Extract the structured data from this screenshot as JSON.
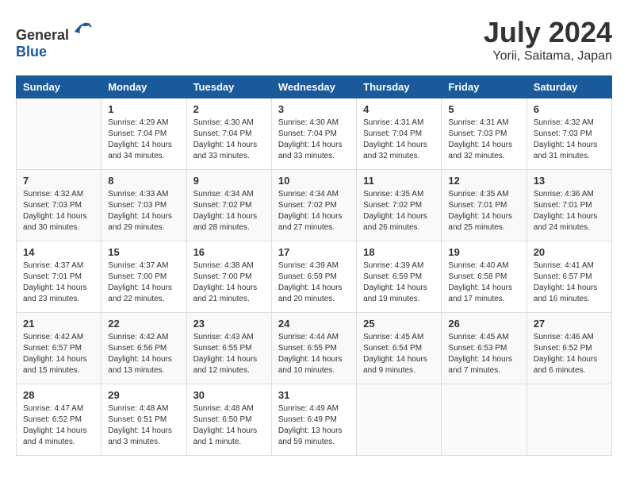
{
  "header": {
    "logo_general": "General",
    "logo_blue": "Blue",
    "month": "July 2024",
    "location": "Yorii, Saitama, Japan"
  },
  "days_of_week": [
    "Sunday",
    "Monday",
    "Tuesday",
    "Wednesday",
    "Thursday",
    "Friday",
    "Saturday"
  ],
  "weeks": [
    [
      {
        "day": "",
        "sunrise": "",
        "sunset": "",
        "daylight": ""
      },
      {
        "day": "1",
        "sunrise": "Sunrise: 4:29 AM",
        "sunset": "Sunset: 7:04 PM",
        "daylight": "Daylight: 14 hours and 34 minutes."
      },
      {
        "day": "2",
        "sunrise": "Sunrise: 4:30 AM",
        "sunset": "Sunset: 7:04 PM",
        "daylight": "Daylight: 14 hours and 33 minutes."
      },
      {
        "day": "3",
        "sunrise": "Sunrise: 4:30 AM",
        "sunset": "Sunset: 7:04 PM",
        "daylight": "Daylight: 14 hours and 33 minutes."
      },
      {
        "day": "4",
        "sunrise": "Sunrise: 4:31 AM",
        "sunset": "Sunset: 7:04 PM",
        "daylight": "Daylight: 14 hours and 32 minutes."
      },
      {
        "day": "5",
        "sunrise": "Sunrise: 4:31 AM",
        "sunset": "Sunset: 7:03 PM",
        "daylight": "Daylight: 14 hours and 32 minutes."
      },
      {
        "day": "6",
        "sunrise": "Sunrise: 4:32 AM",
        "sunset": "Sunset: 7:03 PM",
        "daylight": "Daylight: 14 hours and 31 minutes."
      }
    ],
    [
      {
        "day": "7",
        "sunrise": "Sunrise: 4:32 AM",
        "sunset": "Sunset: 7:03 PM",
        "daylight": "Daylight: 14 hours and 30 minutes."
      },
      {
        "day": "8",
        "sunrise": "Sunrise: 4:33 AM",
        "sunset": "Sunset: 7:03 PM",
        "daylight": "Daylight: 14 hours and 29 minutes."
      },
      {
        "day": "9",
        "sunrise": "Sunrise: 4:34 AM",
        "sunset": "Sunset: 7:02 PM",
        "daylight": "Daylight: 14 hours and 28 minutes."
      },
      {
        "day": "10",
        "sunrise": "Sunrise: 4:34 AM",
        "sunset": "Sunset: 7:02 PM",
        "daylight": "Daylight: 14 hours and 27 minutes."
      },
      {
        "day": "11",
        "sunrise": "Sunrise: 4:35 AM",
        "sunset": "Sunset: 7:02 PM",
        "daylight": "Daylight: 14 hours and 26 minutes."
      },
      {
        "day": "12",
        "sunrise": "Sunrise: 4:35 AM",
        "sunset": "Sunset: 7:01 PM",
        "daylight": "Daylight: 14 hours and 25 minutes."
      },
      {
        "day": "13",
        "sunrise": "Sunrise: 4:36 AM",
        "sunset": "Sunset: 7:01 PM",
        "daylight": "Daylight: 14 hours and 24 minutes."
      }
    ],
    [
      {
        "day": "14",
        "sunrise": "Sunrise: 4:37 AM",
        "sunset": "Sunset: 7:01 PM",
        "daylight": "Daylight: 14 hours and 23 minutes."
      },
      {
        "day": "15",
        "sunrise": "Sunrise: 4:37 AM",
        "sunset": "Sunset: 7:00 PM",
        "daylight": "Daylight: 14 hours and 22 minutes."
      },
      {
        "day": "16",
        "sunrise": "Sunrise: 4:38 AM",
        "sunset": "Sunset: 7:00 PM",
        "daylight": "Daylight: 14 hours and 21 minutes."
      },
      {
        "day": "17",
        "sunrise": "Sunrise: 4:39 AM",
        "sunset": "Sunset: 6:59 PM",
        "daylight": "Daylight: 14 hours and 20 minutes."
      },
      {
        "day": "18",
        "sunrise": "Sunrise: 4:39 AM",
        "sunset": "Sunset: 6:59 PM",
        "daylight": "Daylight: 14 hours and 19 minutes."
      },
      {
        "day": "19",
        "sunrise": "Sunrise: 4:40 AM",
        "sunset": "Sunset: 6:58 PM",
        "daylight": "Daylight: 14 hours and 17 minutes."
      },
      {
        "day": "20",
        "sunrise": "Sunrise: 4:41 AM",
        "sunset": "Sunset: 6:57 PM",
        "daylight": "Daylight: 14 hours and 16 minutes."
      }
    ],
    [
      {
        "day": "21",
        "sunrise": "Sunrise: 4:42 AM",
        "sunset": "Sunset: 6:57 PM",
        "daylight": "Daylight: 14 hours and 15 minutes."
      },
      {
        "day": "22",
        "sunrise": "Sunrise: 4:42 AM",
        "sunset": "Sunset: 6:56 PM",
        "daylight": "Daylight: 14 hours and 13 minutes."
      },
      {
        "day": "23",
        "sunrise": "Sunrise: 4:43 AM",
        "sunset": "Sunset: 6:55 PM",
        "daylight": "Daylight: 14 hours and 12 minutes."
      },
      {
        "day": "24",
        "sunrise": "Sunrise: 4:44 AM",
        "sunset": "Sunset: 6:55 PM",
        "daylight": "Daylight: 14 hours and 10 minutes."
      },
      {
        "day": "25",
        "sunrise": "Sunrise: 4:45 AM",
        "sunset": "Sunset: 6:54 PM",
        "daylight": "Daylight: 14 hours and 9 minutes."
      },
      {
        "day": "26",
        "sunrise": "Sunrise: 4:45 AM",
        "sunset": "Sunset: 6:53 PM",
        "daylight": "Daylight: 14 hours and 7 minutes."
      },
      {
        "day": "27",
        "sunrise": "Sunrise: 4:46 AM",
        "sunset": "Sunset: 6:52 PM",
        "daylight": "Daylight: 14 hours and 6 minutes."
      }
    ],
    [
      {
        "day": "28",
        "sunrise": "Sunrise: 4:47 AM",
        "sunset": "Sunset: 6:52 PM",
        "daylight": "Daylight: 14 hours and 4 minutes."
      },
      {
        "day": "29",
        "sunrise": "Sunrise: 4:48 AM",
        "sunset": "Sunset: 6:51 PM",
        "daylight": "Daylight: 14 hours and 3 minutes."
      },
      {
        "day": "30",
        "sunrise": "Sunrise: 4:48 AM",
        "sunset": "Sunset: 6:50 PM",
        "daylight": "Daylight: 14 hours and 1 minute."
      },
      {
        "day": "31",
        "sunrise": "Sunrise: 4:49 AM",
        "sunset": "Sunset: 6:49 PM",
        "daylight": "Daylight: 13 hours and 59 minutes."
      },
      {
        "day": "",
        "sunrise": "",
        "sunset": "",
        "daylight": ""
      },
      {
        "day": "",
        "sunrise": "",
        "sunset": "",
        "daylight": ""
      },
      {
        "day": "",
        "sunrise": "",
        "sunset": "",
        "daylight": ""
      }
    ]
  ]
}
